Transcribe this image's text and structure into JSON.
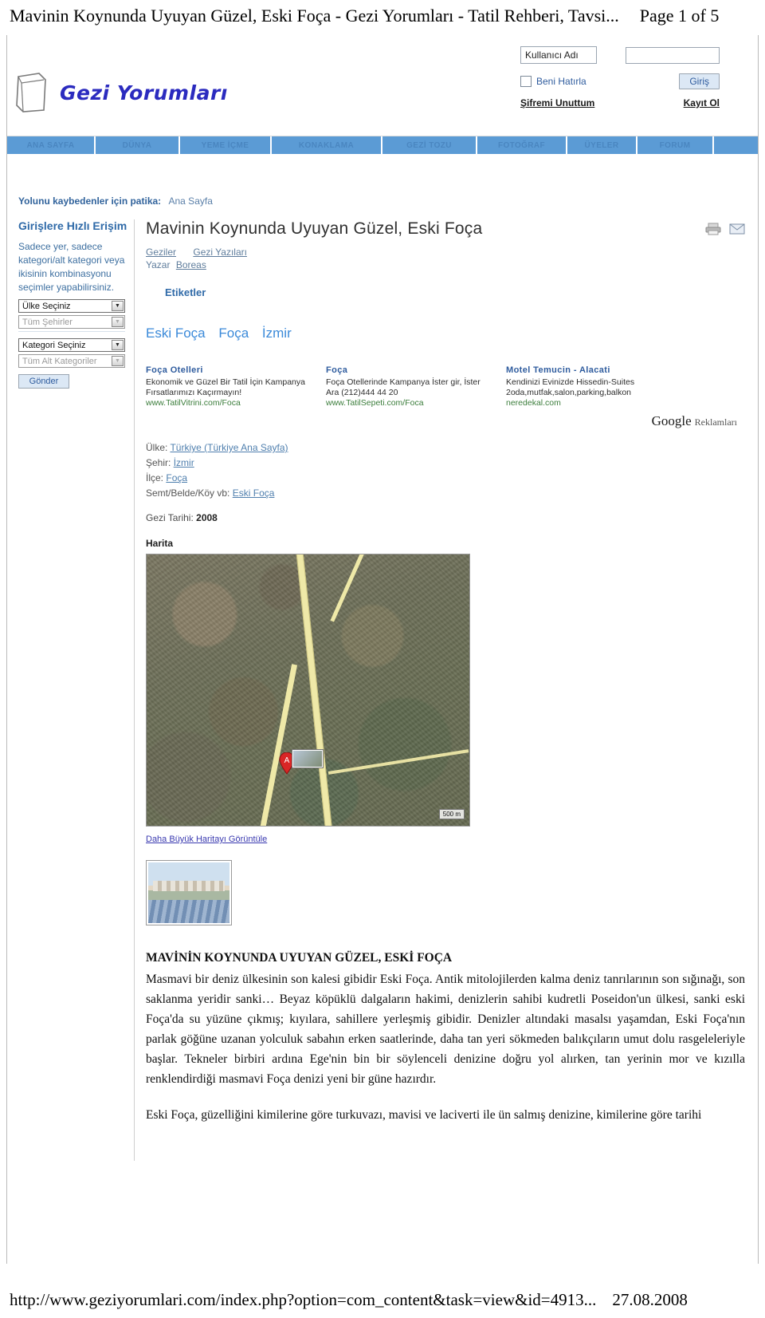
{
  "print": {
    "title": "Mavinin Koynunda Uyuyan Güzel, Eski Foça - Gezi Yorumları - Tatil Rehberi, Tavsi...",
    "page": "Page 1 of 5",
    "url": "http://www.geziyorumlari.com/index.php?option=com_content&task=view&id=4913...",
    "date": "27.08.2008"
  },
  "header": {
    "logo_text": "Gezi Yorumları",
    "login": {
      "username_label": "Kullanıcı Adı",
      "password_value": "",
      "remember_label": "Beni Hatırla",
      "submit_label": "Giriş",
      "forgot_label": "Şifremi Unuttum",
      "register_label": "Kayıt Ol"
    }
  },
  "nav": {
    "items": [
      "ANA SAYFA",
      "DÜNYA",
      "YEME İÇME",
      "KONAKLAMA",
      "GEZİ TOZU",
      "FOTOĞRAF",
      "ÜYELER",
      "FORUM"
    ]
  },
  "breadcrumb": {
    "label": "Yolunu kaybedenler için patika:",
    "current": "Ana Sayfa"
  },
  "sidebar": {
    "heading": "Girişlere Hızlı Erişim",
    "description": "Sadece yer, sadece kategori/alt kategori veya ikisinin kombinasyonu seçimler yapabilirsiniz.",
    "selects": [
      {
        "value": "Ülke Seçiniz",
        "disabled": false
      },
      {
        "value": "Tüm Şehirler",
        "disabled": true
      },
      {
        "value": "Kategori Seçiniz",
        "disabled": false
      },
      {
        "value": "Tüm Alt Kategoriler",
        "disabled": true
      }
    ],
    "submit_label": "Gönder"
  },
  "article": {
    "title": "Mavinin Koynunda Uyuyan Güzel, Eski Foça",
    "meta_links": [
      "Geziler",
      "Gezi Yazıları"
    ],
    "author_label": "Yazar",
    "author_name": "Boreas",
    "tags_heading": "Etiketler",
    "tags": [
      "Eski Foça",
      "Foça",
      "İzmir"
    ],
    "icons": {
      "print": "printer-icon",
      "email": "envelope-icon"
    }
  },
  "ads": {
    "google_mark_g": "Google",
    "google_mark_r": "Reklamları",
    "items": [
      {
        "title": "Foça Otelleri",
        "line1": "Ekonomik ve Güzel Bir Tatil İçin Kampanya",
        "line2": "Fırsatlarımızı Kaçırmayın!",
        "url": "www.TatilVitrini.com/Foca"
      },
      {
        "title": "Foça",
        "line1": "Foça Otellerinde Kampanya İster gir, İster",
        "line2": "Ara (212)444 44 20",
        "url": "www.TatilSepeti.com/Foca"
      },
      {
        "title": "Motel Temucin - Alacati",
        "line1": "Kendinizi Evinizde Hissedin-Suites",
        "line2": "2oda,mutfak,salon,parking,balkon",
        "url": "neredekal.com"
      }
    ]
  },
  "location": {
    "rows": [
      {
        "label": "Ülke:",
        "value": "Türkiye (Türkiye Ana Sayfa)"
      },
      {
        "label": "Şehir:",
        "value": "İzmir"
      },
      {
        "label": "İlçe:",
        "value": "Foça"
      },
      {
        "label": "Semt/Belde/Köy vb:",
        "value": "Eski Foça"
      }
    ],
    "trip_date_label": "Gezi Tarihi:",
    "trip_date_value": "2008"
  },
  "map": {
    "label": "Harita",
    "scale": "500 m",
    "marker": "A",
    "bigger_link": "Daha Büyük Haritayı Görüntüle"
  },
  "body": {
    "heading": "MAVİNİN KOYNUNDA UYUYAN GÜZEL, ESKİ FOÇA",
    "paragraph1": "Masmavi bir deniz ülkesinin son kalesi gibidir Eski Foça. Antik mitolojilerden kalma deniz tanrılarının son sığınağı, son saklanma yeridir sanki… Beyaz köpüklü dalgaların hakimi, denizlerin sahibi kudretli Poseidon'un ülkesi, sanki eski Foça'da su yüzüne çıkmış; kıyılara, sahillere yerleşmiş gibidir. Denizler altındaki masalsı yaşamdan, Eski Foça'nın parlak göğüne uzanan yolculuk sabahın erken saatlerinde, daha tan yeri sökmeden balıkçıların umut dolu rasgeleleriyle başlar. Tekneler birbiri ardına Ege'nin bin bir söylenceli denizine doğru yol alırken, tan yerinin mor ve kızılla renklendirdiği masmavi Foça denizi yeni bir güne hazırdır.",
    "paragraph2": "Eski Foça, güzelliğini kimilerine göre turkuvazı, mavisi ve laciverti ile ün salmış denizine, kimilerine göre tarihi"
  },
  "colors": {
    "nav_blue": "#5b9bd5",
    "link_blue": "#3b8ad9",
    "heading_blue": "#2f6aa8",
    "ad_url_green": "#3b7d3b"
  }
}
